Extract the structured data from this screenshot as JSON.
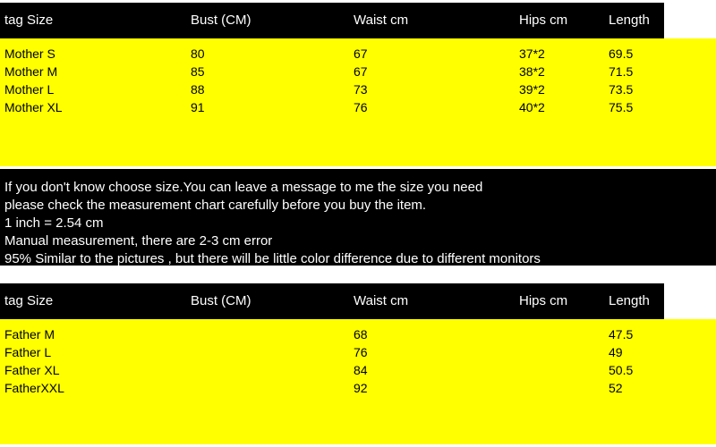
{
  "tables": [
    {
      "id": "mother",
      "columns": [
        {
          "key": "size",
          "label": "tag Size"
        },
        {
          "key": "bust",
          "label": "Bust (CM)"
        },
        {
          "key": "waist",
          "label": "Waist cm"
        },
        {
          "key": "hips",
          "label": "Hips cm"
        },
        {
          "key": "length",
          "label": "Length"
        }
      ],
      "rows": [
        {
          "size": "Mother S",
          "bust": "80",
          "waist": "67",
          "hips": "37*2",
          "length": "69.5"
        },
        {
          "size": "Mother M",
          "bust": "85",
          "waist": "67",
          "hips": "38*2",
          "length": "71.5"
        },
        {
          "size": "Mother L",
          "bust": "88",
          "waist": "73",
          "hips": "39*2",
          "length": "73.5"
        },
        {
          "size": "Mother XL",
          "bust": "91",
          "waist": "76",
          "hips": "40*2",
          "length": "75.5"
        }
      ]
    },
    {
      "id": "father",
      "columns": [
        {
          "key": "size",
          "label": "tag Size"
        },
        {
          "key": "bust",
          "label": "Bust (CM)"
        },
        {
          "key": "waist",
          "label": "Waist cm"
        },
        {
          "key": "hips",
          "label": "Hips cm"
        },
        {
          "key": "length",
          "label": "Length"
        }
      ],
      "rows": [
        {
          "size": "Father M",
          "bust": "",
          "waist": "68",
          "hips": "",
          "length": "47.5"
        },
        {
          "size": "Father L",
          "bust": "",
          "waist": "76",
          "hips": "",
          "length": "49"
        },
        {
          "size": "Father XL",
          "bust": "",
          "waist": "84",
          "hips": "",
          "length": "50.5"
        },
        {
          "size": "FatherXXL",
          "bust": "",
          "waist": "92",
          "hips": "",
          "length": "52"
        }
      ]
    }
  ],
  "notes": {
    "lines": [
      "If you don't know choose size.You can leave a message to me the size you need",
      "please check the measurement chart carefully before you buy the item.",
      "1 inch = 2.54 cm",
      "Manual measurement, there are 2-3 cm error",
      "95% Similar to the pictures , but there will be little color difference due to different monitors"
    ]
  },
  "colors": {
    "panel": "#ffff00",
    "header": "#000000",
    "header_text": "#ffffff",
    "body_text": "#000000",
    "page": "#ffffff"
  }
}
